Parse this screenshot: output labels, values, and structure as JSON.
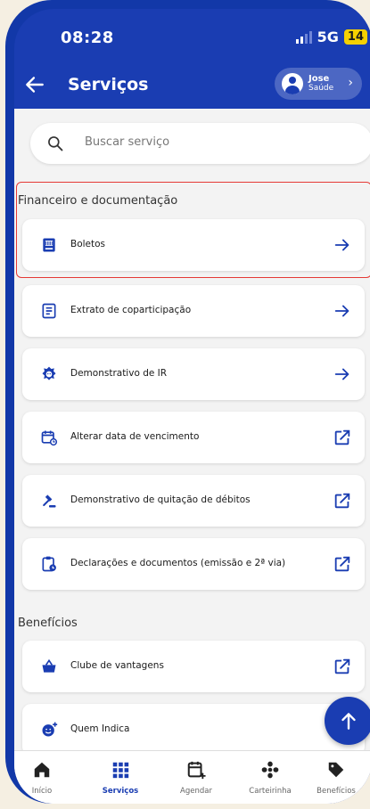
{
  "status_bar": {
    "time": "08:28",
    "network": "5G",
    "battery": "14"
  },
  "header": {
    "title": "Serviços",
    "profile_name": "Jose",
    "profile_plan": "Saúde"
  },
  "search": {
    "placeholder": "Buscar serviço"
  },
  "sections": {
    "financeiro": {
      "title": "Financeiro e documentação",
      "items": [
        {
          "label": "Boletos",
          "icon": "barcode-icon",
          "action": "arrow-right-icon"
        },
        {
          "label": "Extrato de coparticipação",
          "icon": "document-icon",
          "action": "arrow-right-icon"
        },
        {
          "label": "Demonstrativo de IR",
          "icon": "lion-icon",
          "action": "arrow-right-icon"
        },
        {
          "label": "Alterar data de vencimento",
          "icon": "calendar-edit-icon",
          "action": "external-link-icon"
        },
        {
          "label": "Demonstrativo de quitação de débitos",
          "icon": "gavel-icon",
          "action": "external-link-icon"
        },
        {
          "label": "Declarações e documentos (emissão e 2ª via)",
          "icon": "clipboard-icon",
          "action": "external-link-icon"
        }
      ]
    },
    "beneficios": {
      "title": "Benefícios",
      "items": [
        {
          "label": "Clube de vantagens",
          "icon": "basket-icon",
          "action": "external-link-icon"
        },
        {
          "label": "Quem Indica",
          "icon": "smile-plus-icon",
          "action": "external-link-icon"
        }
      ]
    }
  },
  "bottom_nav": [
    {
      "label": "Início",
      "icon": "home-icon",
      "active": false
    },
    {
      "label": "Serviços",
      "icon": "grid-icon",
      "active": true
    },
    {
      "label": "Agendar",
      "icon": "calendar-plus-icon",
      "active": false
    },
    {
      "label": "Carteirinha",
      "icon": "card-icon",
      "active": false
    },
    {
      "label": "Benefícios",
      "icon": "tag-icon",
      "active": false
    }
  ],
  "colors": {
    "primary": "#1a3db2",
    "highlight_border": "#e53935",
    "background": "#f3f3f3"
  }
}
